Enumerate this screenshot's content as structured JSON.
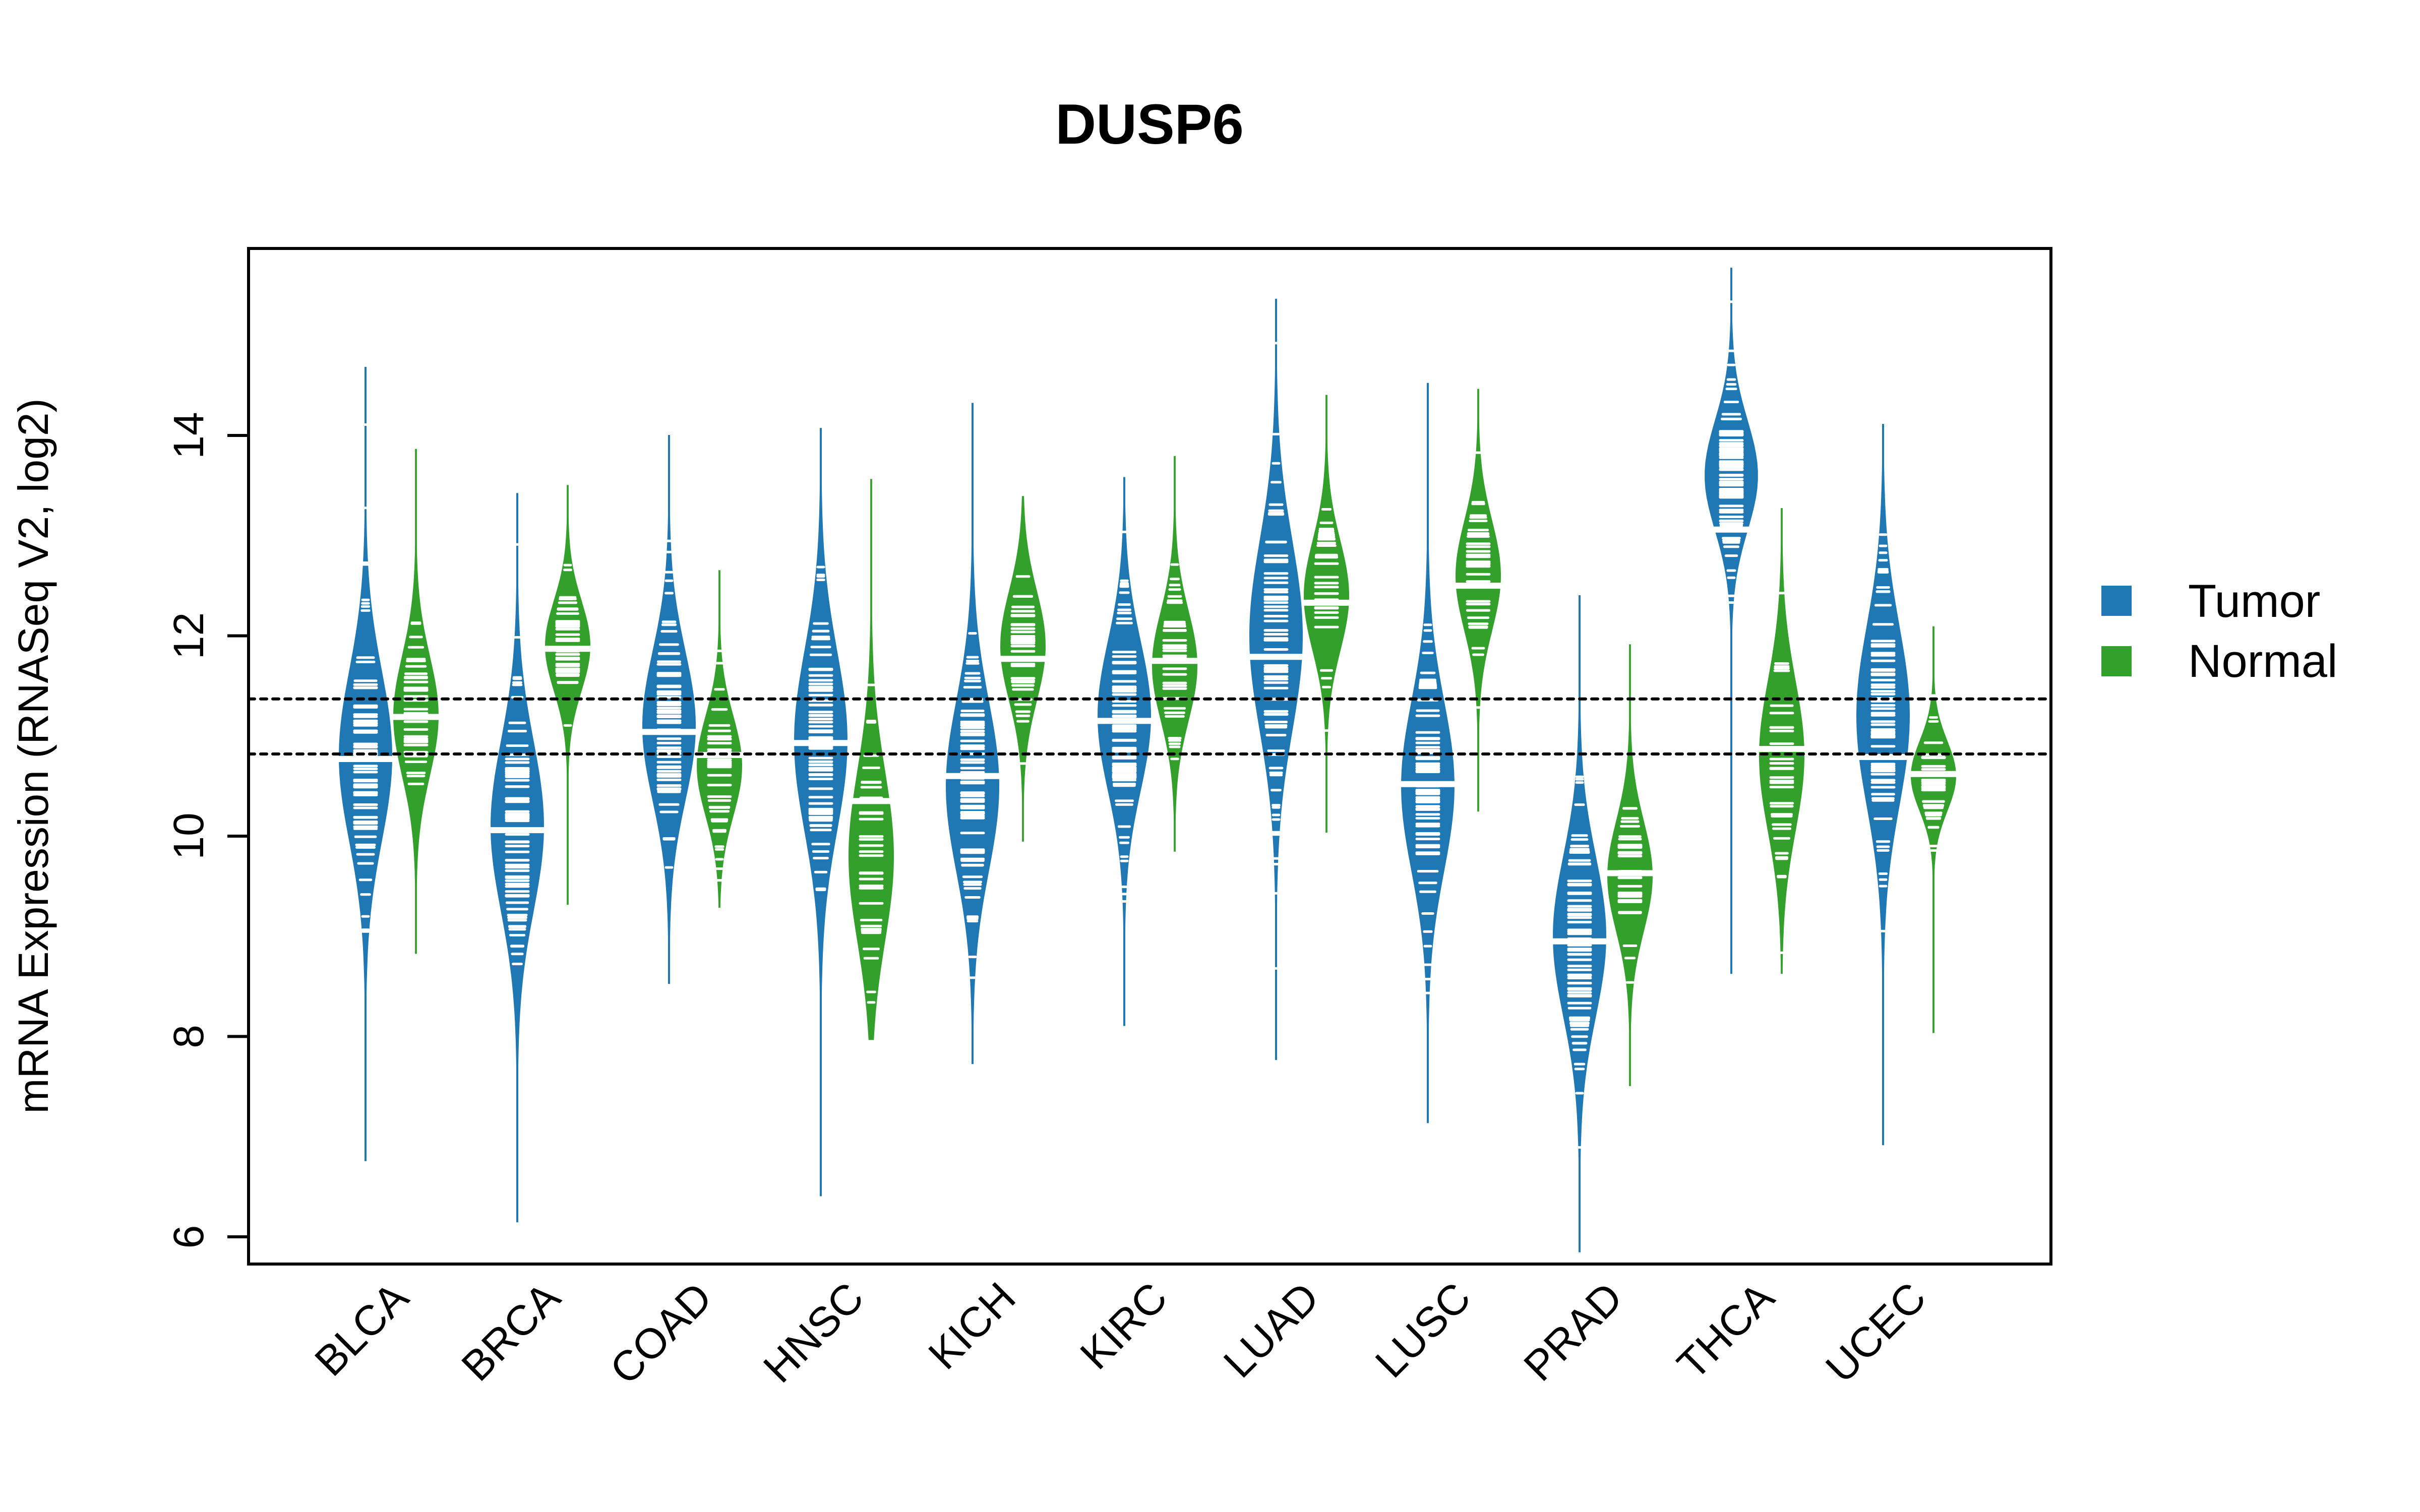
{
  "chart_data": {
    "type": "beanplot",
    "title": "DUSP6",
    "xlabel": "",
    "ylabel": "mRNA Expression (RNASeq V2, log2)",
    "ylim": [
      5.73,
      15.87
    ],
    "yticks": [
      6,
      8,
      10,
      12,
      14
    ],
    "grid": false,
    "reference_lines": [
      {
        "y": 11.37,
        "style": "dotted",
        "color": "#000000"
      },
      {
        "y": 10.82,
        "style": "dotted",
        "color": "#000000"
      }
    ],
    "legend": {
      "placement": "right",
      "entries": [
        {
          "label": "Tumor",
          "color": "#1F78B4"
        },
        {
          "label": "Normal",
          "color": "#33A02C"
        }
      ]
    },
    "categories": [
      "BLCA",
      "BRCA",
      "COAD",
      "HNSC",
      "KICH",
      "KIRC",
      "LUAD",
      "LUSC",
      "PRAD",
      "THCA",
      "UCEC"
    ],
    "series": [
      {
        "name": "Tumor",
        "color": "#1F78B4",
        "median": [
          10.77,
          10.06,
          11.04,
          10.93,
          10.6,
          11.15,
          11.79,
          10.52,
          8.95,
          13.06,
          10.79
        ],
        "min": [
          6.76,
          6.15,
          8.53,
          6.41,
          7.73,
          8.11,
          7.77,
          7.14,
          5.85,
          8.63,
          6.92
        ],
        "max": [
          14.68,
          13.42,
          14.0,
          14.07,
          14.32,
          13.58,
          15.36,
          14.52,
          12.4,
          15.67,
          14.11
        ],
        "mode": [
          10.8,
          10.1,
          11.1,
          10.95,
          10.5,
          11.2,
          12.0,
          10.5,
          9.0,
          13.6,
          11.2
        ],
        "spread": [
          0.85,
          0.85,
          0.75,
          0.9,
          0.85,
          0.75,
          0.95,
          0.85,
          0.8,
          0.55,
          0.9
        ]
      },
      {
        "name": "Normal",
        "color": "#33A02C",
        "median": [
          11.19,
          11.87,
          10.81,
          10.35,
          11.77,
          11.75,
          12.33,
          12.5,
          9.63,
          10.87,
          10.62
        ],
        "min": [
          8.83,
          9.32,
          9.29,
          7.97,
          9.95,
          9.85,
          10.04,
          10.25,
          7.51,
          8.63,
          8.04
        ],
        "max": [
          13.86,
          13.5,
          12.65,
          13.56,
          13.39,
          13.79,
          14.4,
          14.46,
          11.91,
          13.27,
          12.09
        ],
        "mode": [
          11.2,
          11.9,
          10.7,
          9.8,
          11.9,
          11.7,
          12.4,
          12.6,
          9.6,
          10.8,
          10.6
        ],
        "spread": [
          0.6,
          0.45,
          0.5,
          0.85,
          0.55,
          0.55,
          0.55,
          0.55,
          0.55,
          0.75,
          0.35
        ]
      }
    ]
  }
}
